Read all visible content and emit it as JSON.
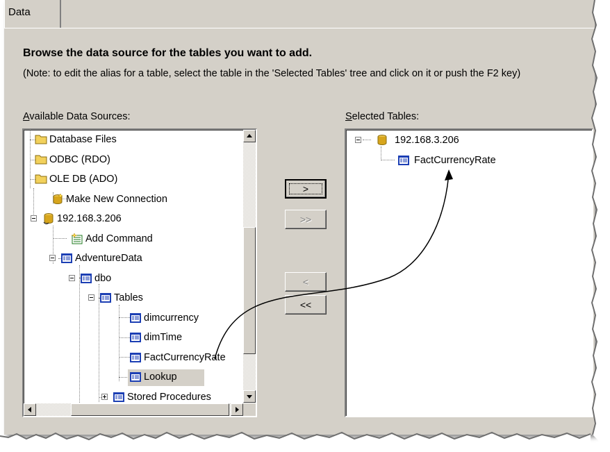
{
  "tab": {
    "label": "Data"
  },
  "heading": "Browse the data source for the tables you want to add.",
  "note": "(Note: to edit the alias for a table, select the table in the 'Selected Tables' tree and click on it or push the F2 key)",
  "available": {
    "label_prefix": "A",
    "label_rest": "vailable Data Sources:",
    "items": [
      {
        "label": "Database Files",
        "icon": "folder-icon"
      },
      {
        "label": "ODBC (RDO)",
        "icon": "folder-icon"
      },
      {
        "label": "OLE DB (ADO)",
        "icon": "folder-icon"
      },
      {
        "label": "Make New Connection",
        "icon": "new-connection-icon"
      },
      {
        "label": "192.168.3.206",
        "icon": "database-icon"
      },
      {
        "label": "Add Command",
        "icon": "add-command-icon"
      },
      {
        "label": "AdventureData",
        "icon": "table-icon"
      },
      {
        "label": "dbo",
        "icon": "table-icon"
      },
      {
        "label": "Tables",
        "icon": "table-icon"
      },
      {
        "label": "dimcurrency",
        "icon": "table-icon"
      },
      {
        "label": "dimTime",
        "icon": "table-icon"
      },
      {
        "label": "FactCurrencyRate",
        "icon": "table-icon"
      },
      {
        "label": "Lookup",
        "icon": "table-icon",
        "selected": true
      },
      {
        "label": "Stored Procedures",
        "icon": "table-icon"
      }
    ]
  },
  "selected": {
    "label_prefix": "S",
    "label_rest": "elected Tables:",
    "items": [
      {
        "label": "192.168.3.206",
        "icon": "database-icon"
      },
      {
        "label": "FactCurrencyRate",
        "icon": "table-icon"
      }
    ]
  },
  "buttons": {
    "add": ">",
    "add_all": ">>",
    "remove": "<",
    "remove_all": "<<"
  },
  "colors": {
    "dialog_bg": "#d4d0c8",
    "folder": "#f2d15c",
    "table_icon": "#1c3fb4",
    "database": "#d7a51c"
  }
}
